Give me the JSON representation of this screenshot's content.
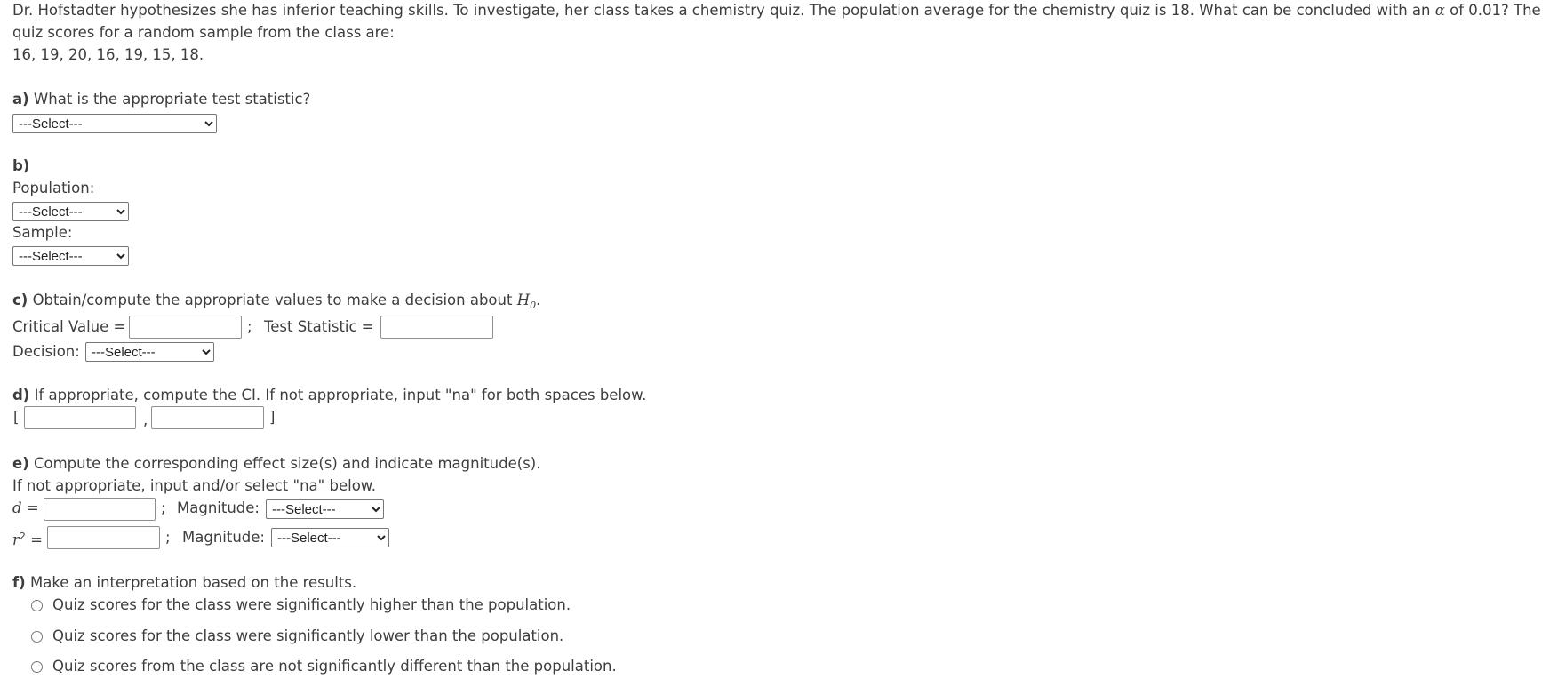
{
  "problem": {
    "line1_part1": "Dr. Hofstadter hypothesizes she has inferior teaching skills.  To investigate, her class takes a chemistry quiz.  The population average for the chemistry quiz is 18.  What can be concluded with an ",
    "alpha_symbol": "α",
    "line1_part2": " of 0.01?  The",
    "line2": "quiz scores for a random sample from the class are:",
    "scores": "16, 19, 20, 16, 19, 15, 18."
  },
  "part_a": {
    "letter": "a)",
    "question": " What is the appropriate test statistic?",
    "select_value": "---Select---"
  },
  "part_b": {
    "letter": "b)",
    "population_label": "Population:",
    "population_select": "---Select---",
    "sample_label": "Sample:",
    "sample_select": "---Select---"
  },
  "part_c": {
    "letter": "c)",
    "question": " Obtain/compute the appropriate values to make a decision about ",
    "h_symbol": "H",
    "h_sub": "0",
    "period": ".",
    "critical_label": "Critical Value =",
    "critical_value": "",
    "separator": ";",
    "test_stat_label": "Test Statistic =",
    "test_stat_value": "",
    "decision_label": "Decision:",
    "decision_select": "---Select---"
  },
  "part_d": {
    "letter": "d)",
    "question": " If appropriate, compute the CI. If not appropriate, input \"na\" for both spaces below.",
    "open_bracket": "[",
    "comma": ",",
    "close_bracket": "]",
    "lower_value": "",
    "upper_value": ""
  },
  "part_e": {
    "letter": "e)",
    "question": " Compute the corresponding effect size(s) and indicate magnitude(s).",
    "instruction": "If not appropriate, input and/or select \"na\" below.",
    "d_symbol": "d",
    "r_symbol": "r",
    "r_sup": "2",
    "equals": "=",
    "separator": ";",
    "magnitude_label": "Magnitude:",
    "d_value": "",
    "r2_value": "",
    "d_magnitude_select": "---Select---",
    "r2_magnitude_select": "---Select---"
  },
  "part_f": {
    "letter": "f)",
    "question": " Make an interpretation based on the results.",
    "options": [
      "Quiz scores for the class were significantly higher than the population.",
      "Quiz scores for the class were significantly lower than the population.",
      "Quiz scores from the class are not significantly different than the population."
    ]
  }
}
